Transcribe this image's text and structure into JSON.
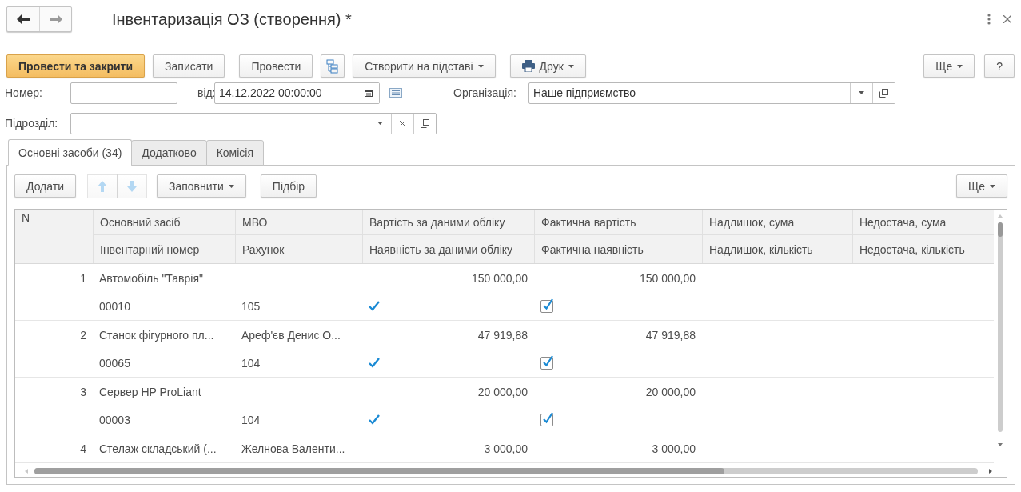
{
  "window": {
    "title": "Інвентаризація ОЗ (створення) *"
  },
  "toolbar": {
    "left": [
      {
        "kind": "primary",
        "label": "Провести та закрити"
      },
      {
        "kind": "plain",
        "label": "Записати"
      },
      {
        "kind": "plain",
        "label": "Провести"
      },
      {
        "kind": "structure"
      },
      {
        "kind": "menu",
        "label": "Створити на підставі"
      },
      {
        "kind": "print",
        "label": "Друк"
      }
    ],
    "right": [
      {
        "kind": "menu",
        "label": "Ще"
      },
      {
        "kind": "plain",
        "label": "?"
      }
    ]
  },
  "fields": {
    "number": {
      "label": "Номер:"
    },
    "date": {
      "label": "від:",
      "value": "14.12.2022 00:00:00"
    },
    "organization": {
      "label": "Організація:",
      "value": "Наше підприємство"
    },
    "department": {
      "label": "Підрозділ:"
    }
  },
  "tabs": [
    {
      "label": "Основні засоби (34)",
      "selected": true
    },
    {
      "label": "Додатково",
      "selected": false
    },
    {
      "label": "Комісія",
      "selected": false
    }
  ],
  "table_toolbar": {
    "left": [
      {
        "kind": "plain",
        "label": "Додати"
      },
      {
        "kind": "up",
        "disabled": true
      },
      {
        "kind": "down",
        "disabled": true
      },
      {
        "kind": "menu",
        "label": "Заповнити"
      },
      {
        "kind": "plain",
        "label": "Підбір"
      }
    ],
    "right": [
      {
        "kind": "menu",
        "label": "Ще"
      }
    ]
  },
  "table": {
    "columns": [
      {
        "top": "N"
      },
      {
        "top": "Основний засіб",
        "bottom": "Інвентарний номер"
      },
      {
        "top": "МВО",
        "bottom": "Рахунок"
      },
      {
        "top": "Вартість за даними обліку",
        "bottom": "Наявність за даними обліку"
      },
      {
        "top": "Фактична вартість",
        "bottom": "Фактична наявність"
      },
      {
        "top": "Надлишок, сума",
        "bottom": "Надлишок, кількість"
      },
      {
        "top": "Недостача, сума",
        "bottom": "Недостача, кількість"
      }
    ],
    "rows": [
      {
        "n": "1",
        "asset": "Автомобіль \"Таврія\"",
        "book_value": "150 000,00",
        "actual_value": "150 000,00",
        "inventory_number": "00010",
        "account": "105",
        "book_presence": true,
        "actual_presence": true
      },
      {
        "n": "2",
        "asset": "Станок фігурного пл...",
        "mol": "Ареф'єв Денис О...",
        "book_value": "47 919,88",
        "actual_value": "47 919,88",
        "inventory_number": "00065",
        "account": "104",
        "book_presence": true,
        "actual_presence": true
      },
      {
        "n": "3",
        "asset": "Сервер HP ProLiant",
        "book_value": "20 000,00",
        "actual_value": "20 000,00",
        "inventory_number": "00003",
        "account": "104",
        "book_presence": true,
        "actual_presence": true
      },
      {
        "n": "4",
        "asset": "Стелаж складський (...",
        "mol": "Желнова Валенти...",
        "book_value": "3 000,00",
        "actual_value": "3 000,00"
      }
    ]
  }
}
